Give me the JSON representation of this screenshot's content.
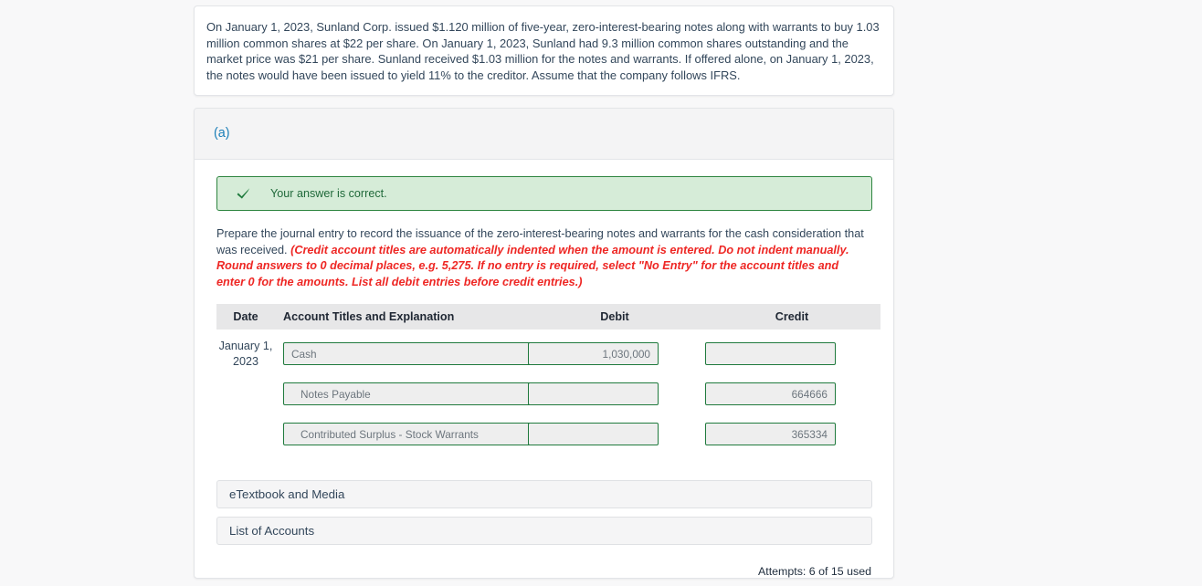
{
  "problem": {
    "text": "On January 1, 2023, Sunland Corp. issued $1.120 million of five-year, zero-interest-bearing notes along with warrants to buy 1.03 million common shares at $22 per share. On January 1, 2023, Sunland had 9.3 million common shares outstanding and the market price was $21 per share. Sunland received $1.03 million for the notes and warrants. If offered alone, on January 1, 2023, the notes would have been issued to yield 11% to the creditor. Assume that the company follows IFRS."
  },
  "part": {
    "label": "(a)"
  },
  "feedback": {
    "icon": "check-icon",
    "message": "Your answer is correct.",
    "background_color": "#d6ecd8",
    "border_color": "#2e8540",
    "text_color": "#20693a"
  },
  "instructions": {
    "lead": "Prepare the journal entry to record the issuance of the zero-interest-bearing notes and warrants for the cash consideration that was received.",
    "note": "(Credit account titles are automatically indented when the amount is entered. Do not indent manually. Round answers to 0 decimal places, e.g. 5,275. If no entry is required, select \"No Entry\" for the account titles and enter 0 for the amounts. List all debit entries before credit entries.)",
    "note_color": "#ee2724"
  },
  "journal": {
    "headers": {
      "date": "Date",
      "account": "Account Titles and Explanation",
      "debit": "Debit",
      "credit": "Credit"
    },
    "date_cell": "January 1, 2023",
    "rows": [
      {
        "account": "Cash",
        "account_placeholder": "",
        "debit": "1,030,000",
        "credit": "",
        "indent": false
      },
      {
        "account": "Notes Payable",
        "account_placeholder": "",
        "debit": "",
        "credit": "664666",
        "indent": true
      },
      {
        "account": "Contributed Surplus - Stock Warrants",
        "account_placeholder": "",
        "debit": "",
        "credit": "365334",
        "indent": true
      }
    ],
    "input_border_color": "#1f7a3d",
    "input_background": "#eeeeee"
  },
  "panels": {
    "etextbook": "eTextbook and Media",
    "accounts": "List of Accounts"
  },
  "attempts": {
    "text": "Attempts: 6 of 15 used"
  }
}
